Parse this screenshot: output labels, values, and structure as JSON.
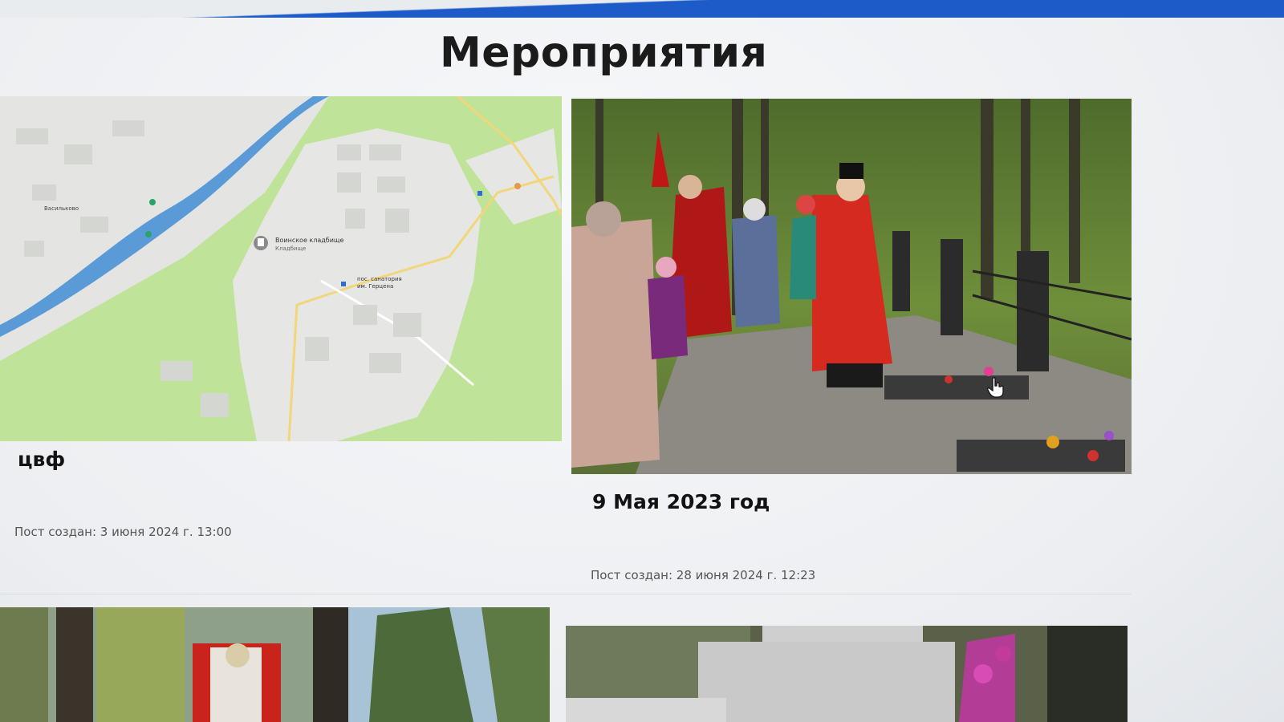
{
  "page": {
    "title": "Мероприятия"
  },
  "posts": [
    {
      "title": "цвф",
      "created": "Пост создан: 3 июня 2024 г. 13:00",
      "image": "map-preview"
    },
    {
      "title": "9 Мая 2023 год",
      "created": "Пост создан: 28 июня 2024 г. 12:23",
      "image": "memorial-ceremony-photo"
    },
    {
      "image": "forest-monument-photo"
    },
    {
      "image": "memorial-stone-photo"
    }
  ],
  "map_labels": {
    "place": "Воинское кладбище",
    "place_sub": "Кладбище",
    "sanatorium": "пос. санатория им. Герцена",
    "village": "Васильково"
  },
  "colors": {
    "accent_bar": "#1d5bc9",
    "map_green": "#b9e08f",
    "map_river": "#5a9ad6"
  }
}
